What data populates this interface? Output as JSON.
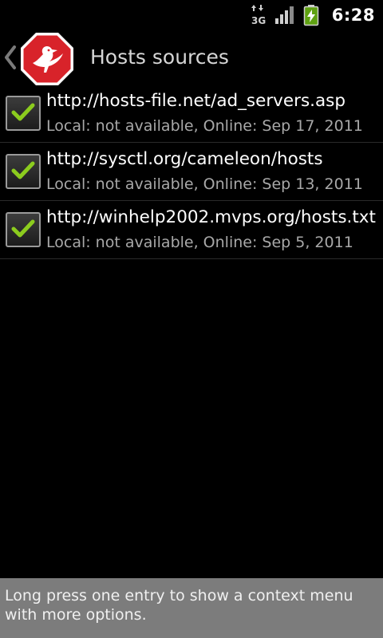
{
  "status_bar": {
    "network_type": "3G",
    "time": "6:28",
    "icons": [
      "data-transfer-3g-icon",
      "signal-strength-icon",
      "battery-charging-icon"
    ]
  },
  "action_bar": {
    "title": "Hosts sources",
    "icons": [
      "up-chevron-icon",
      "app-logo-icon"
    ]
  },
  "hosts_sources": [
    {
      "url": "http://hosts-file.net/ad_servers.asp",
      "summary": "Local: not available, Online: Sep 17, 2011",
      "checked": true
    },
    {
      "url": "http://sysctl.org/cameleon/hosts",
      "summary": "Local: not available, Online: Sep 13, 2011",
      "checked": true
    },
    {
      "url": "http://winhelp2002.mvps.org/hosts.txt",
      "summary": "Local: not available, Online: Sep 5, 2011",
      "checked": true
    }
  ],
  "footer": {
    "hint": "Long press one entry to show a context menu with more options."
  },
  "colors": {
    "background": "#000000",
    "check_green": "#8ccc1e",
    "footer_background": "#7c7c7c",
    "logo_red": "#d8232a"
  }
}
